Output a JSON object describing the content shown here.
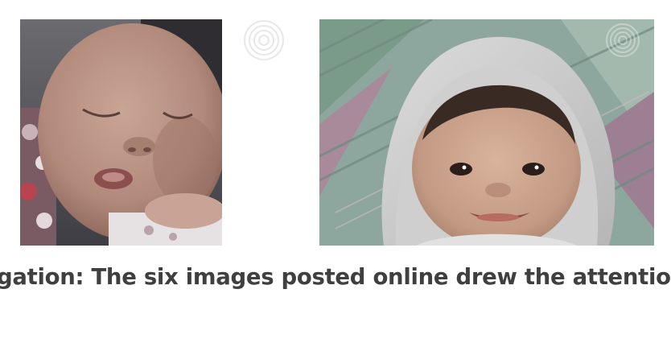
{
  "caption": {
    "text": "gation: The six images posted online drew the attention"
  },
  "images": {
    "left": {
      "icon": "sleeping-baby-photo"
    },
    "right": {
      "icon": "smiling-baby-in-hood-photo"
    }
  },
  "watermark": {
    "icon": "fingerprint-icon"
  },
  "colors": {
    "caption": "#3f3f3f",
    "background": "#ffffff"
  }
}
